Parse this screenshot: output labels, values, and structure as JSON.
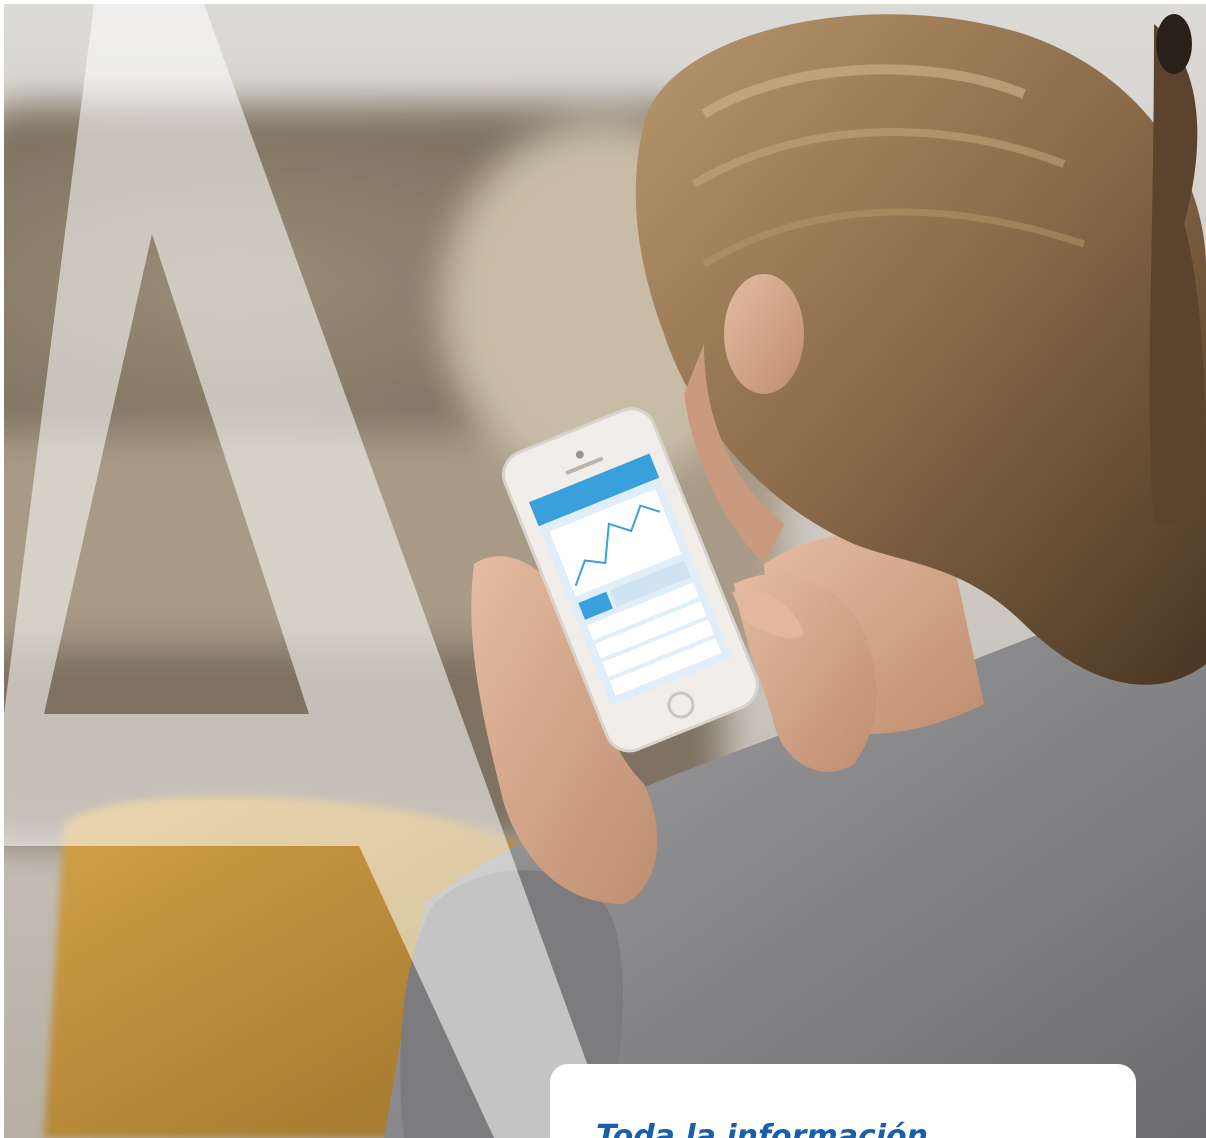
{
  "hero_photo": {
    "subject": "person-using-smartphone-photo",
    "overlay_letter": "A",
    "colors": {
      "wall": "#cfcdc9",
      "sofa": "#8a7a66",
      "sweater": "#8a8a8c",
      "hair": "#8a6a48",
      "skin": "#d6a98c",
      "trousers": "#c09038",
      "phone_body": "#f1eeea",
      "phone_screen": "#dfeef8",
      "phone_header": "#3aa0dc",
      "overlay": "#ffffff"
    }
  },
  "info_card": {
    "title": "Toda la información",
    "title_color": "#1a5fa8"
  }
}
